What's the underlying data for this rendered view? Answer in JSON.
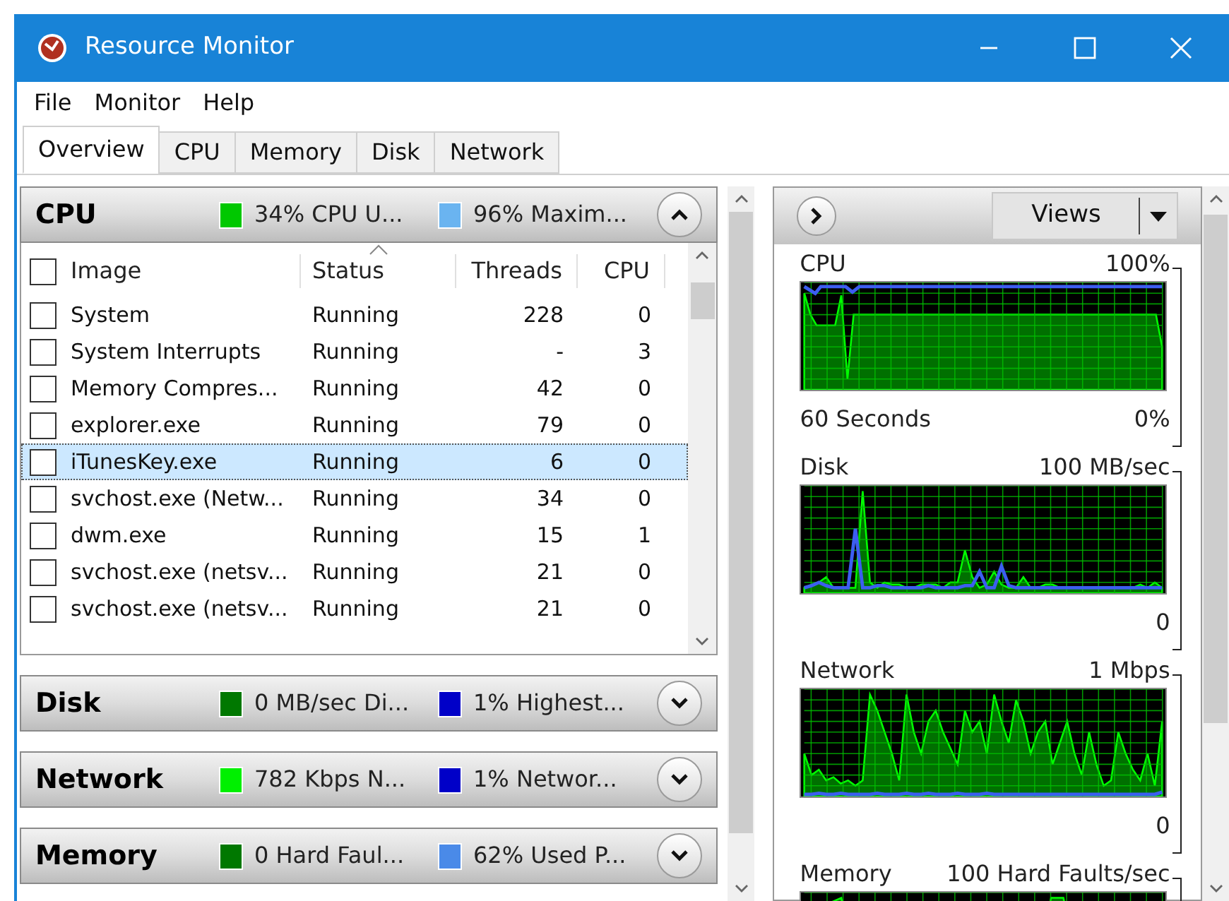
{
  "window": {
    "title": "Resource Monitor"
  },
  "menu": [
    "File",
    "Monitor",
    "Help"
  ],
  "tabs": [
    {
      "label": "Overview",
      "selected": true
    },
    {
      "label": "CPU",
      "selected": false
    },
    {
      "label": "Memory",
      "selected": false
    },
    {
      "label": "Disk",
      "selected": false
    },
    {
      "label": "Network",
      "selected": false
    }
  ],
  "sections": [
    {
      "title": "CPU",
      "expanded": true,
      "indicators": [
        {
          "text": "34% CPU U...",
          "color": "#00c800"
        },
        {
          "text": "96% Maxim...",
          "color": "#6ab4f0"
        }
      ]
    },
    {
      "title": "Disk",
      "expanded": false,
      "indicators": [
        {
          "text": "0 MB/sec Di...",
          "color": "#007800"
        },
        {
          "text": "1% Highest...",
          "color": "#0000c8"
        }
      ]
    },
    {
      "title": "Network",
      "expanded": false,
      "indicators": [
        {
          "text": "782 Kbps N...",
          "color": "#00f000"
        },
        {
          "text": "1% Networ...",
          "color": "#0000c8"
        }
      ]
    },
    {
      "title": "Memory",
      "expanded": false,
      "indicators": [
        {
          "text": "0 Hard Faul...",
          "color": "#007800"
        },
        {
          "text": "62% Used P...",
          "color": "#4a8ae8"
        }
      ]
    }
  ],
  "table": {
    "select_all_checked": false,
    "columns": [
      "Image",
      "Status",
      "Threads",
      "CPU"
    ],
    "rows": [
      {
        "image": "System",
        "status": "Running",
        "threads": "228",
        "cpu": "0",
        "checked": false,
        "selected": false
      },
      {
        "image": "System Interrupts",
        "status": "Running",
        "threads": "-",
        "cpu": "3",
        "checked": false,
        "selected": false
      },
      {
        "image": "Memory Compres...",
        "status": "Running",
        "threads": "42",
        "cpu": "0",
        "checked": false,
        "selected": false
      },
      {
        "image": "explorer.exe",
        "status": "Running",
        "threads": "79",
        "cpu": "0",
        "checked": false,
        "selected": false
      },
      {
        "image": "iTunesKey.exe",
        "status": "Running",
        "threads": "6",
        "cpu": "0",
        "checked": false,
        "selected": true
      },
      {
        "image": "svchost.exe (Netw...",
        "status": "Running",
        "threads": "34",
        "cpu": "0",
        "checked": false,
        "selected": false
      },
      {
        "image": "dwm.exe",
        "status": "Running",
        "threads": "15",
        "cpu": "1",
        "checked": false,
        "selected": false
      },
      {
        "image": "svchost.exe (netsv...",
        "status": "Running",
        "threads": "21",
        "cpu": "0",
        "checked": false,
        "selected": false
      },
      {
        "image": "svchost.exe (netsv...",
        "status": "Running",
        "threads": "21",
        "cpu": "0",
        "checked": false,
        "selected": false
      }
    ]
  },
  "views_button": "Views",
  "graphs": [
    {
      "kind": "cpu",
      "title": "CPU",
      "max": "100%",
      "time": "60 Seconds",
      "min": "0%"
    },
    {
      "kind": "disk",
      "title": "Disk",
      "max": "100 MB/sec",
      "min": "0"
    },
    {
      "kind": "network",
      "title": "Network",
      "max": "1 Mbps",
      "min": "0"
    },
    {
      "kind": "memory",
      "title": "Memory",
      "max": "100 Hard Faults/sec"
    }
  ]
}
